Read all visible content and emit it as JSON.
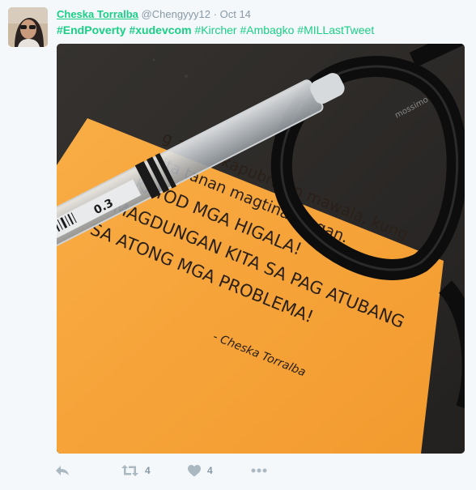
{
  "tweet": {
    "author": {
      "fullname": "Cheska Torralba",
      "username": "@Chengyyy12",
      "separator": "·",
      "time": "Oct 14"
    },
    "hashtags": [
      {
        "text": "#EndPoverty",
        "bold": true
      },
      {
        "text": "#xudevcom",
        "bold": true
      },
      {
        "text": "#Kircher",
        "bold": false
      },
      {
        "text": "#Ambagko",
        "bold": false
      },
      {
        "text": "#MILLastTweet",
        "bold": false
      }
    ],
    "photo": {
      "note_lines": [
        "g atong kapubrihon mawala, kung",
        "kita tanan magtinabangan.",
        "KAYOD MGA HIGALA!",
        "MAGDUNGAN KITA SA PAG ATUBANG",
        "SA ATONG MGA PROBLEMA!"
      ],
      "signature": "- Cheska Torralba",
      "pen_text": "0.3",
      "glasses_brand": "mossimo",
      "note_color": "#f7a539",
      "table_color": "#2e2b28"
    },
    "actions": {
      "retweets": "4",
      "likes": "4"
    }
  }
}
